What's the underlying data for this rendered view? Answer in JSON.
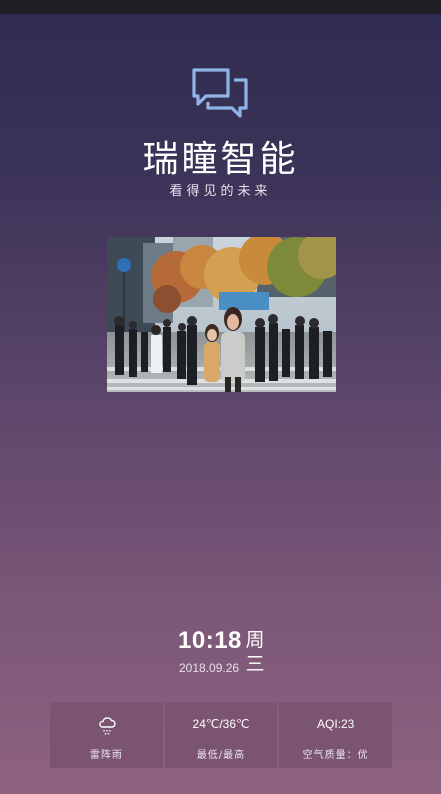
{
  "brand": {
    "title": "瑞瞳智能",
    "subtitle": "看得见的未来",
    "logo_icon": "chat-bubbles-icon",
    "accent_color": "#8fb4e8"
  },
  "photo": {
    "subject": "street-crowd-photo"
  },
  "clock": {
    "time": "10:18",
    "date": "2018.09.26",
    "weekday": "周三"
  },
  "weather": {
    "condition_icon": "thunderstorm-cloud-icon",
    "condition_label": "雷阵雨",
    "temperature": "24℃/36℃",
    "temperature_label": "最低/最高",
    "aqi": "AQI:23",
    "aqi_label": "空气质量：优"
  }
}
